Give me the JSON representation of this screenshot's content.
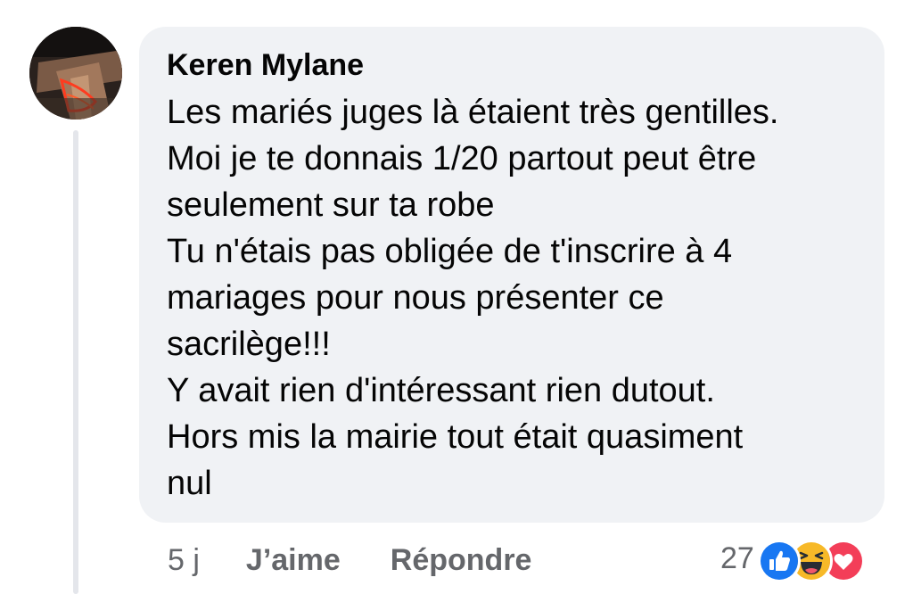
{
  "comment": {
    "author": "Keren Mylane",
    "lines": [
      "Les mariés juges là étaient très gentilles.",
      "Moi je te donnais 1/20 partout peut être",
      "seulement sur ta robe",
      "Tu n'étais pas obligée de t'inscrire à 4",
      "mariages pour nous présenter ce",
      "sacrilège!!!",
      "Y avait rien d'intéressant rien dutout.",
      "Hors mis la mairie tout était quasiment",
      "nul"
    ]
  },
  "actions": {
    "time": "5 j",
    "like_label": "J’aime",
    "reply_label": "Répondre"
  },
  "reactions": {
    "count": "27",
    "icons": [
      "like-icon",
      "haha-icon",
      "love-icon"
    ]
  },
  "colors": {
    "bubble": "#f0f2f5",
    "text": "#050505",
    "secondary_text": "#65676b",
    "like_blue": "#1877f2",
    "haha_yellow": "#f7b928",
    "love_red": "#f33e58"
  }
}
